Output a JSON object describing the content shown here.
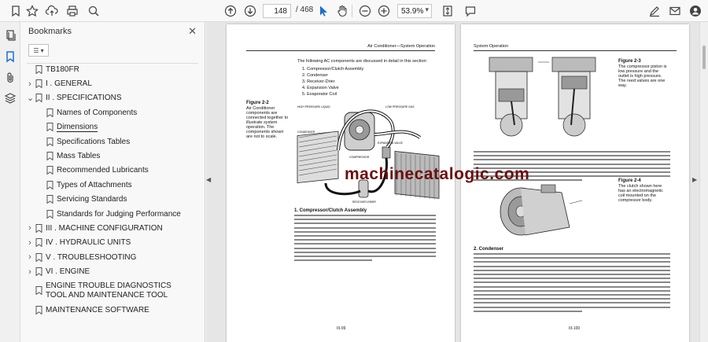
{
  "toolbar": {
    "current_page": "148",
    "total_pages": "/ 468",
    "zoom": "53.9%"
  },
  "bookmarks_panel": {
    "title": "Bookmarks",
    "items": [
      {
        "label": "TB180FR",
        "level": 0,
        "expander": "",
        "selected": false
      },
      {
        "label": "I . GENERAL",
        "level": 0,
        "expander": ">",
        "selected": false
      },
      {
        "label": "II . SPECIFICATIONS",
        "level": 0,
        "expander": "v",
        "selected": false
      },
      {
        "label": "Names of Components",
        "level": 1,
        "expander": "",
        "selected": false
      },
      {
        "label": "Dimensions",
        "level": 1,
        "expander": "",
        "selected": true
      },
      {
        "label": "Specifications Tables",
        "level": 1,
        "expander": "",
        "selected": false
      },
      {
        "label": "Mass Tables",
        "level": 1,
        "expander": "",
        "selected": false
      },
      {
        "label": "Recommended Lubricants",
        "level": 1,
        "expander": "",
        "selected": false
      },
      {
        "label": "Types of Attachments",
        "level": 1,
        "expander": "",
        "selected": false
      },
      {
        "label": "Servicing Standards",
        "level": 1,
        "expander": "",
        "selected": false
      },
      {
        "label": "Standards for Judging Performance",
        "level": 1,
        "expander": "",
        "selected": false
      },
      {
        "label": "III . MACHINE CONFIGURATION",
        "level": 0,
        "expander": ">",
        "selected": false
      },
      {
        "label": "IV . HYDRAULIC UNITS",
        "level": 0,
        "expander": ">",
        "selected": false
      },
      {
        "label": "V . TROUBLESHOOTING",
        "level": 0,
        "expander": ">",
        "selected": false
      },
      {
        "label": "VI . ENGINE",
        "level": 0,
        "expander": ">",
        "selected": false
      },
      {
        "label": "ENGINE TROUBLE DIAGNOSTICS TOOL AND MAINTENANCE TOOL",
        "level": 0,
        "expander": "",
        "selected": false
      },
      {
        "label": "MAINTENANCE SOFTWARE",
        "level": 0,
        "expander": "",
        "selected": false
      }
    ]
  },
  "document": {
    "left_header": "Air Conditioner—System Operation",
    "left_intro": "The following AC components are discussed in detail in this section:",
    "left_list": [
      "1. Compressor/Clutch Assembly",
      "2. Condenser",
      "3. Receiver-Drier",
      "4. Expansion Valve",
      "5. Evaporator Coil"
    ],
    "fig22_title": "Figure 2-2",
    "fig22_text": "Air Conditioner components are connected together to illustrate system operation. The components shown are not to scale.",
    "left_section": "1. Compressor/Clutch Assembly",
    "left_folio": "III-99",
    "right_header": "System Operation",
    "fig23_title": "Figure 2-3",
    "fig23_text": "The compressor piston is low pressure and the outlet is high pressure. The reed valves are one way.",
    "fig24_title": "Figure 2-4",
    "fig24_text": "The clutch shown here has an electromagnetic coil mounted on the compressor body.",
    "right_section": "2. Condenser",
    "right_folio": "III-100",
    "diagram_labels": {
      "high_pressure_liquid": "HIGH PRESSURE LIQUID",
      "low_pressure_gas": "LOW PRESSURE GAS",
      "compressor": "COMPRESSOR",
      "expansion_valve": "EXPANSION VALVE",
      "receiver_drier": "RECEIVER-DRIER",
      "condenser": "CONDENSER"
    }
  },
  "watermark": "machinecatalogic.com",
  "colors": {
    "watermark": "#6b0e0e",
    "accent_blue": "#1a6fd1"
  }
}
